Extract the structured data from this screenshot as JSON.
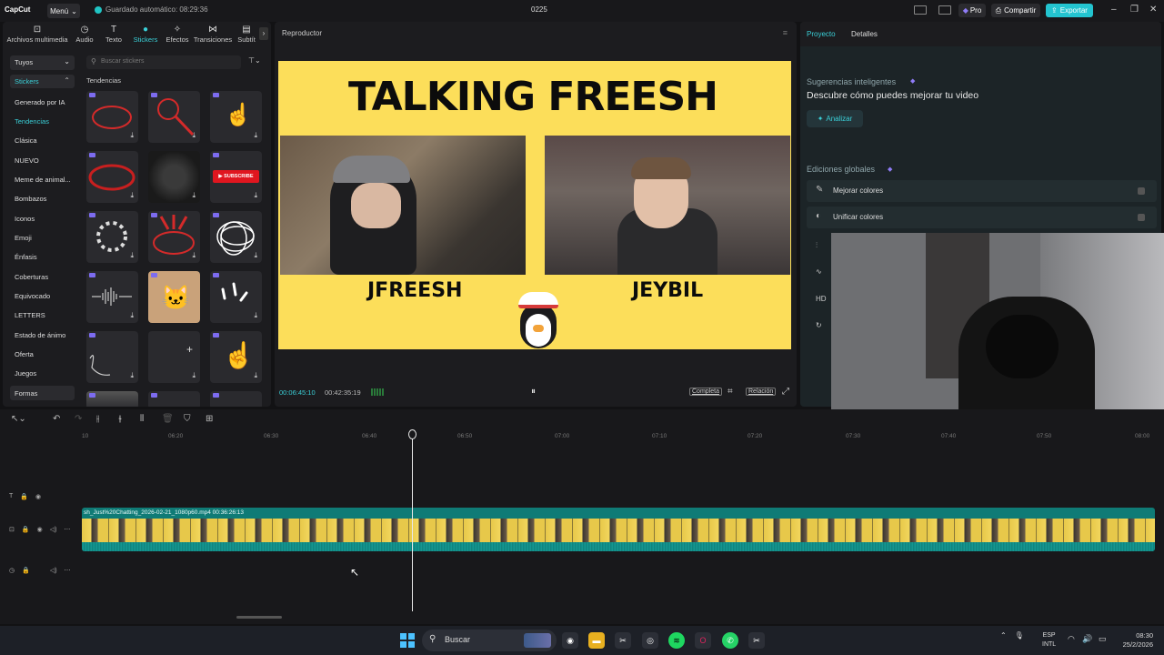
{
  "titlebar": {
    "app_name": "CapCut",
    "menu_label": "Menú",
    "autosave": "Guardado automático: 08:29:36",
    "project_title": "0225",
    "pro_label": "Pro",
    "share_label": "Compartir",
    "export_label": "Exportar"
  },
  "tool_tabs": [
    {
      "label": "Archivos multimedia",
      "icon": "media-icon"
    },
    {
      "label": "Audio",
      "icon": "audio-icon"
    },
    {
      "label": "Texto",
      "icon": "text-icon"
    },
    {
      "label": "Stickers",
      "icon": "sticker-icon"
    },
    {
      "label": "Efectos",
      "icon": "effects-icon"
    },
    {
      "label": "Transiciones",
      "icon": "transitions-icon"
    },
    {
      "label": "Subtít",
      "icon": "subtitles-icon"
    }
  ],
  "categories": {
    "dropdown": "Tuyos",
    "selected": "Stickers",
    "items": [
      "Generado por IA",
      "Tendencias",
      "Clásica",
      "NUEVO",
      "Meme de animal...",
      "Bombazos",
      "Iconos",
      "Emoji",
      "Énfasis",
      "Coberturas",
      "Equivocado",
      "LETTERS",
      "Estado de ánimo",
      "Oferta",
      "Juegos",
      "Formas"
    ]
  },
  "search": {
    "placeholder": "Buscar stickers"
  },
  "section_title": "Tendencias",
  "player": {
    "title": "Reproductor",
    "video_title": "TALKING FREESH",
    "name_left": "JFREESH",
    "name_right": "JEYBIL",
    "time_current": "00:06:45:10",
    "time_total": "00:42:35:19",
    "full_label": "Completa",
    "ratio_label": "Relación"
  },
  "right_panel": {
    "tab_project": "Proyecto",
    "tab_details": "Detalles",
    "smart_title": "Sugerencias inteligentes",
    "smart_sub": "Descubre cómo puedes mejorar tu video",
    "analyze_label": "Analizar",
    "global_title": "Ediciones globales",
    "row1": "Mejorar colores",
    "row2": "Unificar colores",
    "hd_label": "HD"
  },
  "timeline": {
    "ticks": [
      "10",
      "06:20",
      "06:30",
      "06:40",
      "06:50",
      "07:00",
      "07:10",
      "07:20",
      "07:30",
      "07:40",
      "07:50",
      "08:00"
    ],
    "clip_label": "sh_Just%20Chatting_2026-02-21_1080p60.mp4   00:36:26:13"
  },
  "taskbar": {
    "search_label": "Buscar",
    "lang_top": "ESP",
    "lang_bottom": "INTL",
    "time": "08:30",
    "date": "25/2/2026"
  },
  "colors": {
    "accent": "#23c4d0",
    "clip": "#0f7b76",
    "video_bg": "#fcde5a"
  }
}
